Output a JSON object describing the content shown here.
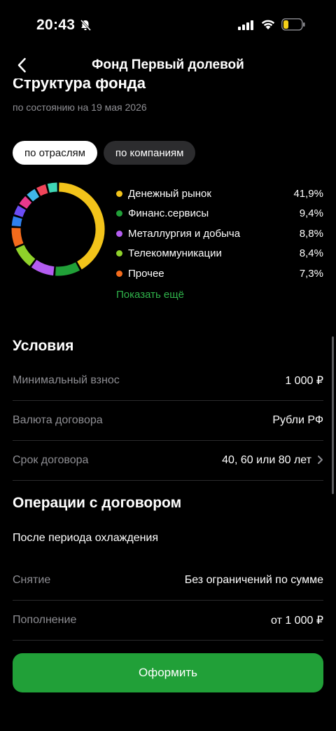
{
  "status": {
    "time": "20:43"
  },
  "nav": {
    "title": "Фонд Первый долевой"
  },
  "structure": {
    "title": "Структура фонда",
    "as_of": "по состоянию на 19 мая 2026",
    "tabs": [
      {
        "label": "по отраслям",
        "active": true
      },
      {
        "label": "по компаниям",
        "active": false
      }
    ],
    "legend": [
      {
        "name": "Денежный рынок",
        "value": "41,9%",
        "color": "#f2c31a"
      },
      {
        "name": "Финанс.сервисы",
        "value": "9,4%",
        "color": "#21a038"
      },
      {
        "name": "Металлургия и добыча",
        "value": "8,8%",
        "color": "#b35cf0"
      },
      {
        "name": "Телекоммуникации",
        "value": "8,4%",
        "color": "#8fd12a"
      },
      {
        "name": "Прочее",
        "value": "7,3%",
        "color": "#f36b1c"
      }
    ],
    "show_more": "Показать ещё"
  },
  "chart_data": {
    "type": "pie",
    "categories": [
      "Денежный рынок",
      "Финанс.сервисы",
      "Металлургия и добыча",
      "Телекоммуникации",
      "Прочее"
    ],
    "values": [
      41.9,
      9.4,
      8.8,
      8.4,
      7.3
    ]
  },
  "conditions": {
    "title": "Условия",
    "rows": [
      {
        "label": "Минимальный взнос",
        "value": "1 000 ₽"
      },
      {
        "label": "Валюта договора",
        "value": "Рубли РФ"
      },
      {
        "label": "Срок договора",
        "value": "40, 60 или 80 лет"
      }
    ]
  },
  "operations": {
    "title": "Операции с договором",
    "subtitle": "После периода охлаждения",
    "rows": [
      {
        "label": "Снятие",
        "value": "Без ограничений по сумме"
      },
      {
        "label": "Пополнение",
        "value": "от 1 000 ₽"
      }
    ]
  },
  "action": {
    "label": "Оформить"
  },
  "colors": {
    "accent": "#21a038",
    "link": "#30b44b",
    "background": "#000000",
    "muted": "#8e8e93"
  }
}
